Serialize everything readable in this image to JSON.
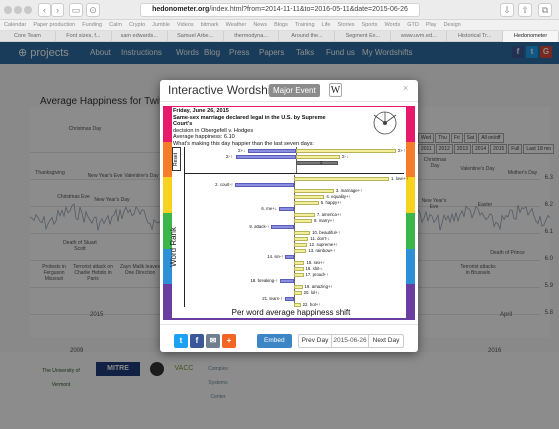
{
  "browser": {
    "url_host": "hedonometer.org",
    "url_path": "/index.html?from=2014-11-11&to=2016-05-11&date=2015-06-26",
    "bookmarks": [
      "Calendar",
      "Paper production",
      "Funding",
      "Calm",
      "Crypto",
      "Jumble",
      "Videos",
      "bitmark",
      "Weather",
      "News",
      "Blogs",
      "Training",
      "Life",
      "Stories",
      "Sports",
      "Words",
      "GTD",
      "Play",
      "Design"
    ],
    "tabs": [
      "Core Team",
      "Font sizes, f...",
      "sam edwards...",
      "Samuel Arbe...",
      "thermodyna...",
      "Around the...",
      "Segment Ex...",
      "www.uvm.ed...",
      "Historical Tr...",
      "Hedonometer"
    ]
  },
  "site": {
    "brand": "projects",
    "nav": [
      "About",
      "Instructions",
      "Words",
      "Blog",
      "Press",
      "Papers",
      "Talks",
      "Fund us",
      "My Wordshifts"
    ],
    "chart_title": "Average Happiness for Twitter",
    "yvals": [
      "6.4",
      "6.3",
      "6.2",
      "6.1",
      "6.0",
      "5.9",
      "5.8"
    ],
    "day_buttons": [
      "Wed",
      "Thu",
      "Fri",
      "Sat",
      "All on/off"
    ],
    "year_buttons": [
      "2011",
      "2012",
      "2013",
      "2014",
      "2015",
      "Full",
      "Last 18 mo"
    ],
    "annotations_left": [
      "Christmas Day",
      "Valentine's Day",
      "New Year's Eve",
      "Thanksgiving",
      "New Year's Day",
      "Christmas Eve",
      "Death of Stuart Scott",
      "Terrorist attack on Charlie Hebdo in Paris",
      "Zayn Malik leaves One Direction",
      "Protests in Ferguson Missouri"
    ],
    "annotations_right": [
      "Christmas Day",
      "Valentine's Day",
      "Mother's Day",
      "New Year's Eve",
      "Easter",
      "Terrorist attacks in Brussels",
      "Death of Prince"
    ],
    "years": [
      "2015",
      "2009",
      "2016",
      "April",
      "2016"
    ],
    "footer_logos": [
      "The University of Vermont",
      "MITRE",
      "VACC",
      "Complex Systems Center"
    ]
  },
  "modal": {
    "title": "Interactive Wordshift",
    "badge": "Major Event",
    "w_button": "W",
    "close": "×",
    "info": {
      "date": "Friday, June 26, 2015",
      "headline": "Same-sex marriage declared legal in the U.S. by Supreme Court's",
      "headline2": "decision in Obergefell v. Hodges",
      "avg": "Average happiness: 6.10",
      "question": "What's making this day happier than the last seven days:"
    },
    "reset_label": "Reset",
    "y_label": "Word Rank",
    "x_label": "Per word average happiness shift",
    "words": [
      {
        "label": "1. love+↑",
        "dir": "up",
        "value": 1.0
      },
      {
        "label": "2. court-↑",
        "dir": "dn",
        "value": 0.62
      },
      {
        "label": "3. marriage+↑",
        "dir": "up",
        "value": 0.42
      },
      {
        "label": "4. equality+↑",
        "dir": "up",
        "value": 0.32
      },
      {
        "label": "5. happy+↑",
        "dir": "up",
        "value": 0.26
      },
      {
        "label": "6. me+↓",
        "dir": "dn",
        "value": 0.16
      },
      {
        "label": "7. america+↑",
        "dir": "up",
        "value": 0.22
      },
      {
        "label": "8. marry+↑",
        "dir": "up",
        "value": 0.19
      },
      {
        "label": "9. attack-↑",
        "dir": "dn",
        "value": 0.24
      },
      {
        "label": "10. beautiful+↑",
        "dir": "up",
        "value": 0.17
      },
      {
        "label": "11. don't-↓",
        "dir": "up",
        "value": 0.15
      },
      {
        "label": "12. supreme+↑",
        "dir": "up",
        "value": 0.14
      },
      {
        "label": "13. rainbow+↑",
        "dir": "up",
        "value": 0.13
      },
      {
        "label": "14. sin-↑",
        "dir": "dn",
        "value": 0.09
      },
      {
        "label": "15. sex+↑",
        "dir": "up",
        "value": 0.11
      },
      {
        "label": "16. shit-↓",
        "dir": "up",
        "value": 0.1
      },
      {
        "label": "17. proud+↑",
        "dir": "up",
        "value": 0.1
      },
      {
        "label": "18. breaking-↑",
        "dir": "dn",
        "value": 0.15
      },
      {
        "label": "19. amazing+↑",
        "dir": "up",
        "value": 0.09
      },
      {
        "label": "20. lol+↓",
        "dir": "up",
        "value": 0.08
      },
      {
        "label": "21. tears-↑",
        "dir": "dn",
        "value": 0.1
      },
      {
        "label": "22. hot+↑",
        "dir": "up",
        "value": 0.07
      }
    ],
    "sums": [
      {
        "label": "Σ+↓",
        "dir": "dn"
      },
      {
        "label": "Σ+↑",
        "dir": "up"
      },
      {
        "label": "Σ-↑",
        "dir": "dn"
      },
      {
        "label": "Σ-↓",
        "dir": "up"
      },
      {
        "label": "Σ",
        "dir": "gray"
      }
    ],
    "footer": {
      "embed": "Embed",
      "prev": "Prev Day",
      "date": "2015-06-26",
      "next": "Next Day"
    }
  },
  "colors": {
    "rainbow": [
      "#e6196d",
      "#f47c2b",
      "#f7d21e",
      "#3cb54a",
      "#2d8fd6",
      "#6a3da1"
    ],
    "nav_bg": "#2c6ea3",
    "embed": "#3d86c6"
  }
}
